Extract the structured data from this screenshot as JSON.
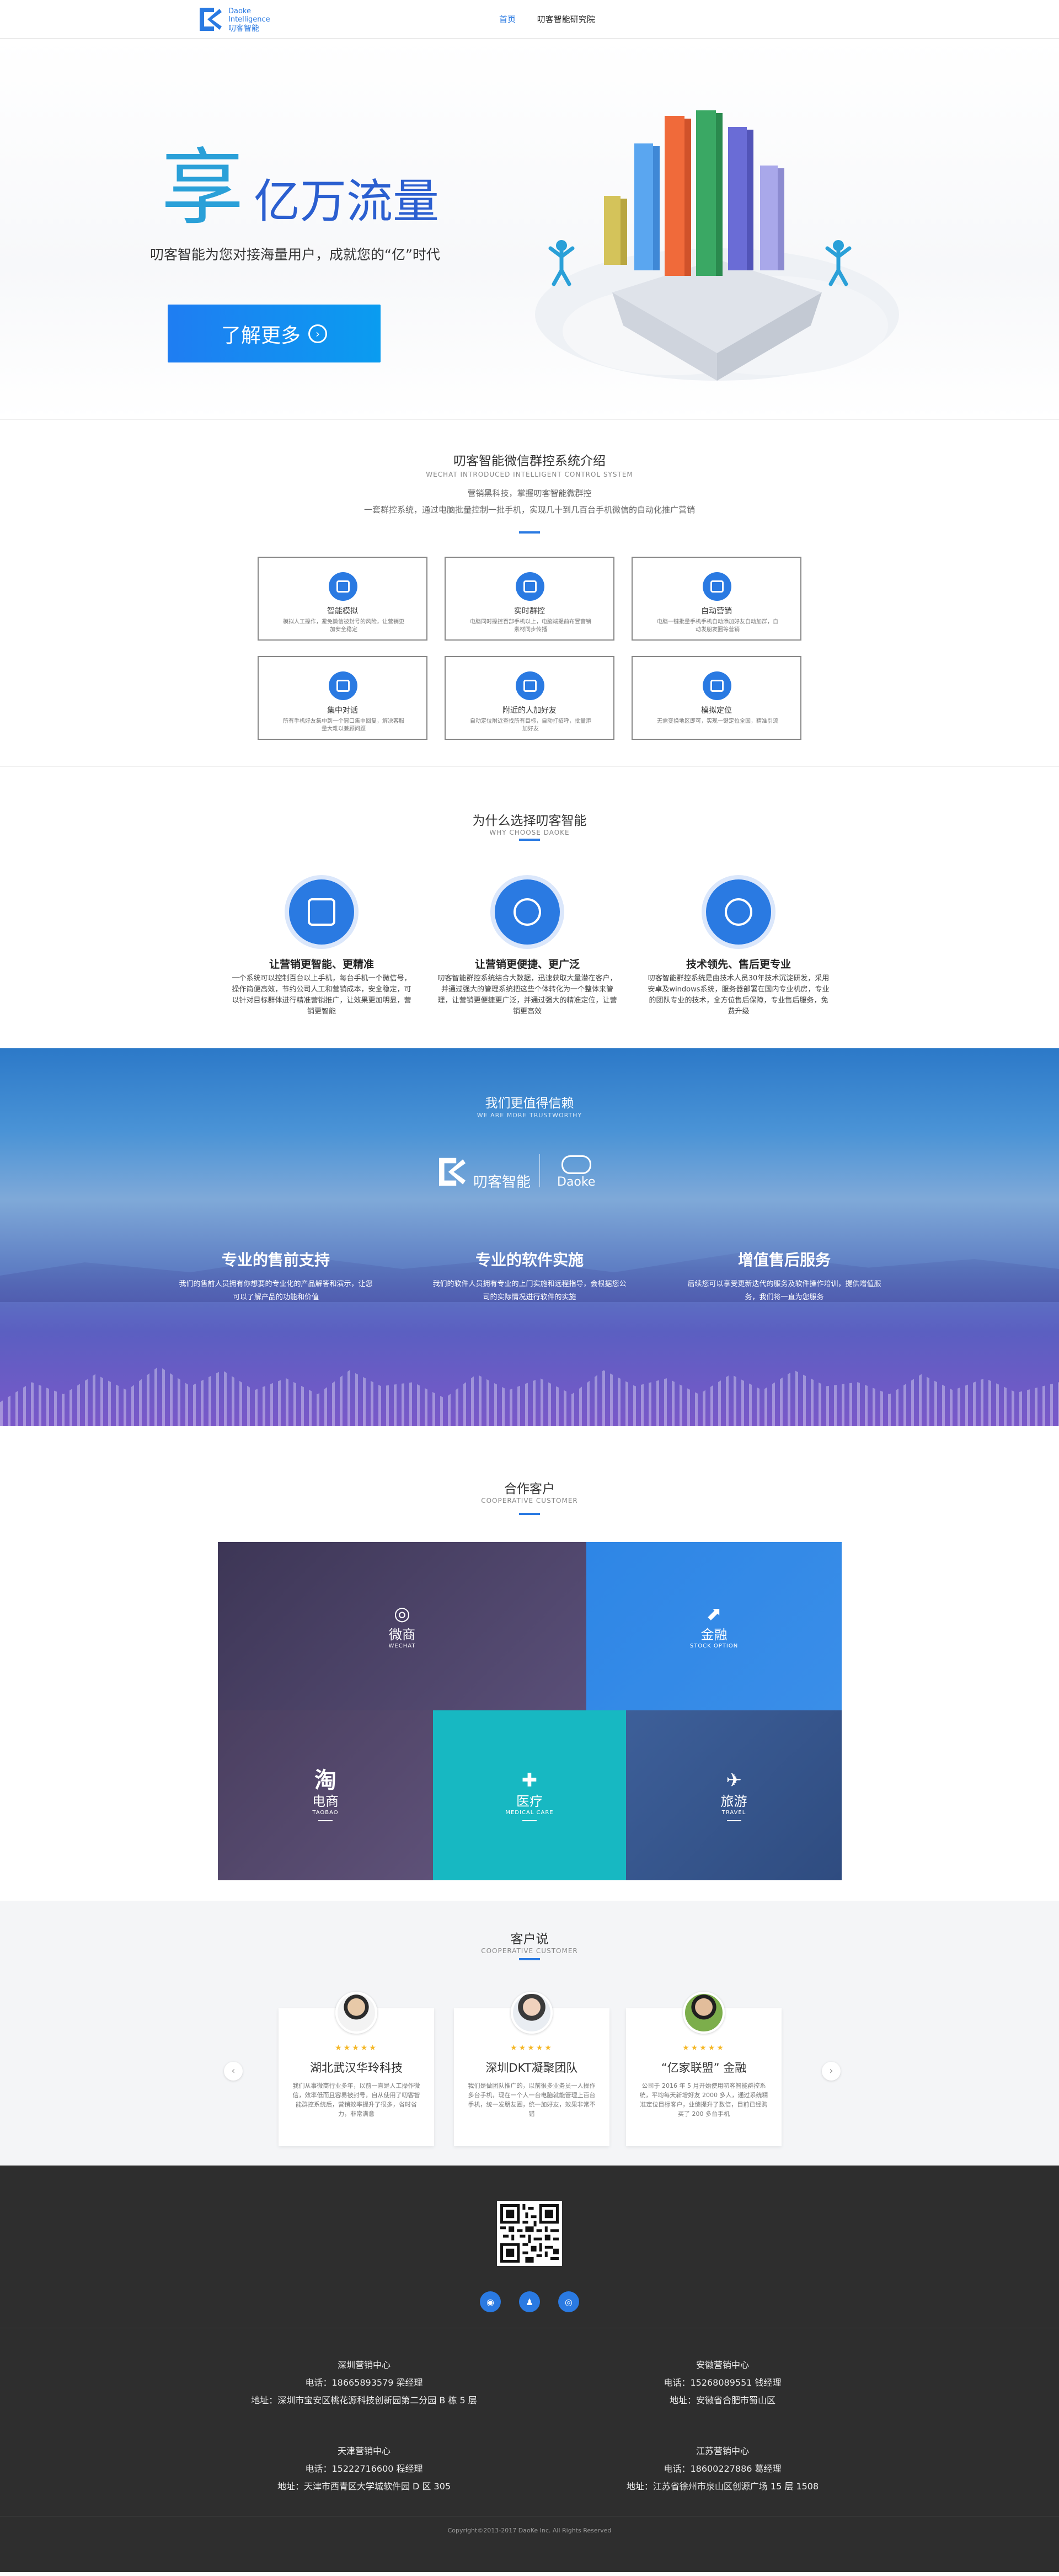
{
  "header": {
    "logo_en_1": "Daoke",
    "logo_en_2": "Intelligence",
    "logo_cn": "叨客智能",
    "nav": [
      "首页",
      "叨客智能研究院"
    ]
  },
  "hero": {
    "big_char": "享",
    "headline": "亿万流量",
    "tagline": "叨客智能为您对接海量用户，成就您的“亿”时代",
    "cta": "了解更多"
  },
  "intro": {
    "title": "叨客智能微信群控系统介绍",
    "title_en": "WECHAT INTRODUCED INTELLIGENT CONTROL SYSTEM",
    "line1": "营销黑科技，掌握叨客智能微群控",
    "line2": "一套群控系统，通过电脑批量控制一批手机，实现几十到几百台手机微信的自动化推广营销",
    "cards": [
      {
        "icon": "smart-sim-icon",
        "title": "智能模拟",
        "desc": "模拟人工操作，避免微信被封号的风险，让营销更加安全稳定"
      },
      {
        "icon": "realtime-control-icon",
        "title": "实时群控",
        "desc": "电脑同时操控百部手机以上，电脑端提前布置营销素材同步传播"
      },
      {
        "icon": "auto-marketing-icon",
        "title": "自动营销",
        "desc": "电脑一键批量手机手机自动添加好友自动加群，自动发朋友圈等营销"
      },
      {
        "icon": "chat-icon",
        "title": "集中对话",
        "desc": "所有手机好友集中到一个窗口集中回复，解决客服量大难以兼顾问题"
      },
      {
        "icon": "nearby-icon",
        "title": "附近的人加好友",
        "desc": "自动定位附近查找所有目标，自动打招呼，批量添加好友"
      },
      {
        "icon": "location-icon",
        "title": "模拟定位",
        "desc": "无需变换地区即可，实现一键定位全国，精准引流"
      }
    ]
  },
  "why": {
    "title": "为什么选择叨客智能",
    "title_en": "WHY CHOOSE DAOKE",
    "items": [
      {
        "icon": "monitor-icon",
        "title": "让营销更智能、更精准",
        "desc": "一个系统可以控制百台以上手机，每台手机一个微信号，操作简便高效，节约公司人工和营销成本，安全稳定，可以针对目标群体进行精准营销推广，让效果更加明显，营销更智能"
      },
      {
        "icon": "globe-icon",
        "title": "让营销更便捷、更广泛",
        "desc": "叨客智能群控系统结合大数据，迅速获取大量潜在客户，并通过强大的管理系统把这些个体转化为一个整体来管理，让营销更便捷更广泛，并通过强大的精准定位，让营销更高效"
      },
      {
        "icon": "atom-icon",
        "title": "技术领先、售后更专业",
        "desc": "叨客智能群控系统是由技术人员30年技术沉淀研发，采用安卓及windows系统，服务器部署在国内专业机房，专业的团队专业的技术，全方位售后保障，专业售后服务，免费升级"
      }
    ]
  },
  "trust": {
    "title": "我们更值得信赖",
    "title_en": "WE ARE MORE TRUSTWORTHY",
    "logo_cn": "叨客智能",
    "logo_en": "Daoke",
    "cols": [
      {
        "title": "专业的售前支持",
        "desc": "我们的售前人员拥有你想要的专业化的产品解答和演示，让您可以了解产品的功能和价值"
      },
      {
        "title": "专业的软件实施",
        "desc": "我们的软件人员拥有专业的上门实施和远程指导，会根据您公司的实际情况进行软件的实施"
      },
      {
        "title": "增值售后服务",
        "desc": "后续您可以享受更新迭代的服务及软件操作培训，提供增值服务，我们将一直为您服务"
      }
    ]
  },
  "partners": {
    "title": "合作客户",
    "title_en": "COOPERATIVE CUSTOMER",
    "tiles": [
      {
        "icon": "wechat-icon",
        "name": "微商",
        "en": "WECHAT"
      },
      {
        "icon": "chart-icon",
        "name": "金融",
        "en": "STOCK OPTION"
      },
      {
        "icon": "taobao-icon",
        "glyph": "淘",
        "name": "电商",
        "en": "TAOBAO"
      },
      {
        "icon": "medical-icon",
        "name": "医疗",
        "en": "MEDICAL CARE"
      },
      {
        "icon": "plane-icon",
        "name": "旅游",
        "en": "TRAVEL"
      }
    ]
  },
  "testimonials": {
    "title": "客户说",
    "title_en": "COOPERATIVE CUSTOMER",
    "items": [
      {
        "name": "湖北武汉华玲科技",
        "stars": "★★★★★",
        "text": "我们从事微商行业多年，以前一直是人工操作微信，效率低而且容易被封号，自从使用了叨客智能群控系统后，营销效率提升了很多，省时省力，非常满意"
      },
      {
        "name": "深圳DKT凝聚团队",
        "stars": "★★★★★",
        "text": "我们是做团队推广的，以前很多业务员一人操作多台手机，现在一个人一台电脑就能管理上百台手机，统一发朋友圈，统一加好友，效果非常不错"
      },
      {
        "name": "“亿家联盟” 金融",
        "stars": "★★★★★",
        "text": "公司于 2016 年 5 月开始使用叨客智能群控系统，平均每天新增好友 2000 多人，通过系统精准定位目标客户，业绩提升了数倍，目前已经购买了 200 多台手机"
      }
    ]
  },
  "footer": {
    "social": [
      "weibo-icon",
      "qq-icon",
      "wechat-icon"
    ],
    "offices": [
      {
        "name": "深圳营销中心",
        "phone": "电话：18665893579 梁经理",
        "addr": "地址：深圳市宝安区桃花源科技创新园第二分园 B 栋 5 层"
      },
      {
        "name": "安徽营销中心",
        "phone": "电话：15268089551 钱经理",
        "addr": "地址：安徽省合肥市蜀山区"
      },
      {
        "name": "天津营销中心",
        "phone": "电话：15222716600 程经理",
        "addr": "地址：天津市西青区大学城软件园 D 区 305"
      },
      {
        "name": "江苏营销中心",
        "phone": "电话：18600227886 葛经理",
        "addr": "地址：江苏省徐州市泉山区创源广场 15 层 1508"
      }
    ],
    "copyright": "Copyright©2013-2017 DaoKe Inc. All Rights Reserved"
  }
}
